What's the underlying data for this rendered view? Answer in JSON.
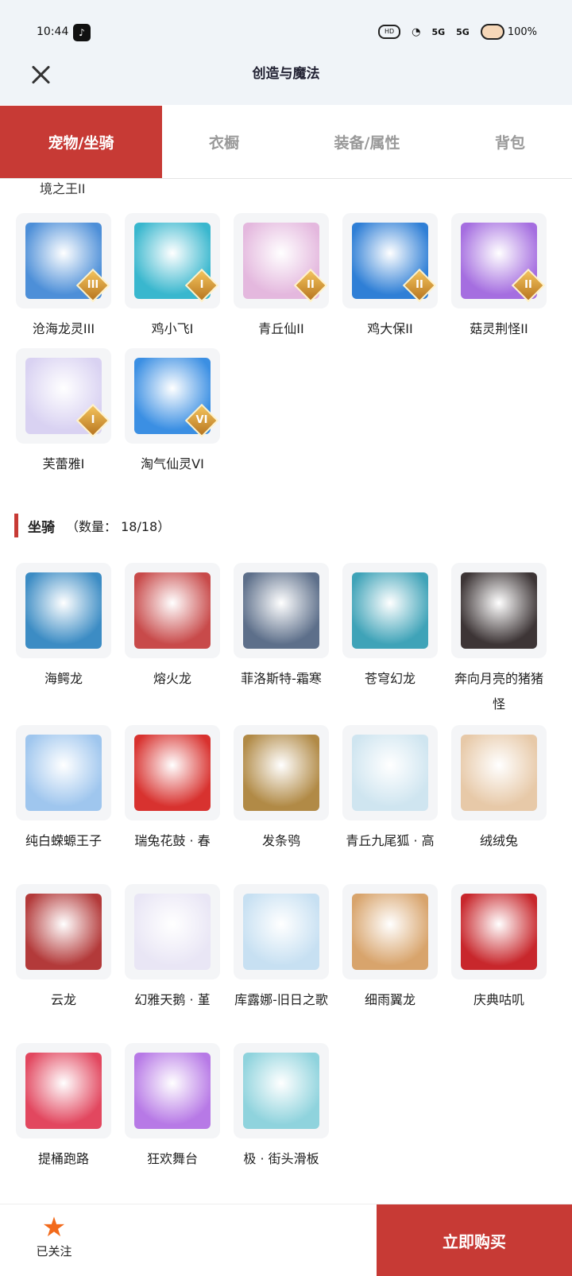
{
  "status_bar": {
    "time": "10:44",
    "battery": "100%",
    "signal1": "5G",
    "signal2": "5G"
  },
  "header": {
    "title": "创造与魔法"
  },
  "tabs": [
    {
      "label": "宠物/坐骑",
      "active": true
    },
    {
      "label": "衣橱",
      "active": false
    },
    {
      "label": "装备/属性",
      "active": false
    },
    {
      "label": "背包",
      "active": false
    }
  ],
  "pets": {
    "cut_label": "境之王II",
    "items": [
      {
        "name": "沧海龙灵III",
        "badge": "III",
        "color": "#4d8fd8"
      },
      {
        "name": "鸡小飞I",
        "badge": "I",
        "color": "#39b7ce"
      },
      {
        "name": "青丘仙II",
        "badge": "II",
        "color": "#e4b8de"
      },
      {
        "name": "鸡大保II",
        "badge": "II",
        "color": "#2f7fd6"
      },
      {
        "name": "菇灵荆怪II",
        "badge": "II",
        "color": "#a56ee0"
      },
      {
        "name": "芙蕾雅I",
        "badge": "I",
        "color": "#d9d2f2"
      },
      {
        "name": "淘气仙灵VI",
        "badge": "VI",
        "color": "#3b8fe3"
      }
    ]
  },
  "mounts": {
    "section_label": "坐骑",
    "count_label": "（数量： 18/18）",
    "items": [
      {
        "name": "海鳄龙",
        "color": "#3c8cc4"
      },
      {
        "name": "熔火龙",
        "color": "#c84a4a"
      },
      {
        "name": "菲洛斯特-霜寒",
        "color": "#5d6f8a"
      },
      {
        "name": "苍穹幻龙",
        "color": "#3fa3b8"
      },
      {
        "name": "奔向月亮的猪猪怪",
        "color": "#3d3536"
      },
      {
        "name": "纯白蝾螈王子",
        "color": "#9fc6ee"
      },
      {
        "name": "瑞兔花鼓 · 春",
        "color": "#d8322f"
      },
      {
        "name": "发条鸮",
        "color": "#b18a46"
      },
      {
        "name": "青丘九尾狐 · 高",
        "color": "#cfe5f0"
      },
      {
        "name": "绒绒兔",
        "color": "#e7c9a8"
      },
      {
        "name": "云龙",
        "color": "#b33a3a"
      },
      {
        "name": "幻雅天鹅 · 堇",
        "color": "#e9e6f5"
      },
      {
        "name": "库露娜-旧日之歌",
        "color": "#c7e0f2"
      },
      {
        "name": "细雨翼龙",
        "color": "#d8a46c"
      },
      {
        "name": "庆典咕叽",
        "color": "#c8272c"
      },
      {
        "name": "提桶跑路",
        "color": "#e2475f"
      },
      {
        "name": "狂欢舞台",
        "color": "#b779e6"
      },
      {
        "name": "极 · 街头滑板",
        "color": "#8fd3dd"
      }
    ]
  },
  "footer": {
    "follow_label": "已关注",
    "buy_label": "立即购买"
  }
}
